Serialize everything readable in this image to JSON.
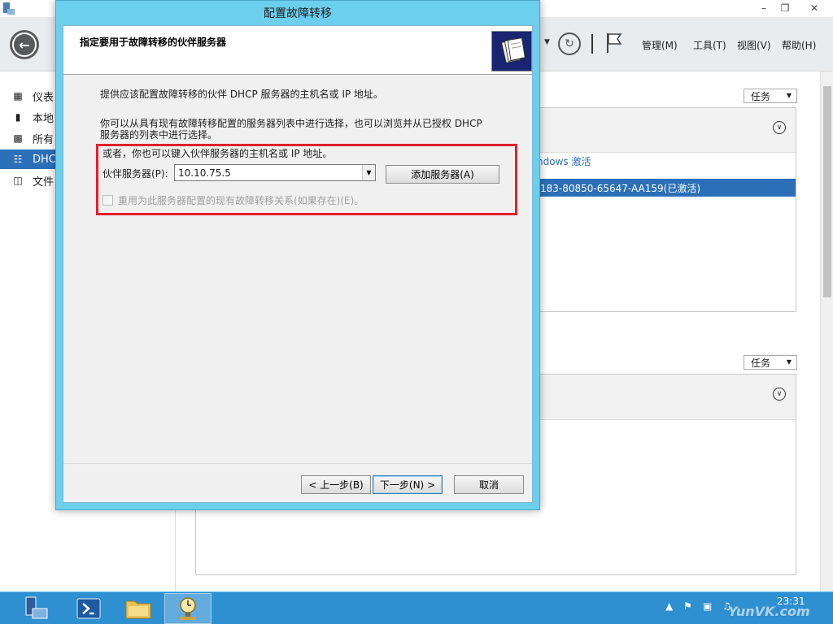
{
  "sm": {
    "toolbar": {
      "menu_manage": "管理(M)",
      "menu_tools": "工具(T)",
      "menu_view": "视图(V)",
      "menu_help": "帮助(H)"
    },
    "sidebar": {
      "items": [
        {
          "label": "仪表"
        },
        {
          "label": "本地"
        },
        {
          "label": "所有"
        },
        {
          "label": "DHC"
        },
        {
          "label": "文件"
        }
      ]
    },
    "tasks_label_1": "任务",
    "tasks_label_2": "任务",
    "column_header": "ndows 激活",
    "selected_row": "183-80850-65647-AA159(已激活)"
  },
  "dialog": {
    "title": "配置故障转移",
    "header_title": "指定要用于故障转移的伙伴服务器",
    "intro_text": "提供应该配置故障转移的伙伴 DHCP 服务器的主机名或 IP 地址。",
    "select_text_line1": "你可以从具有现有故障转移配置的服务器列表中进行选择，也可以浏览并从已授权 DHCP",
    "select_text_line2": "服务器的列表中进行选择。",
    "or_text": "或者，你也可以键入伙伴服务器的主机名或 IP 地址。",
    "partner_label": "伙伴服务器(P):",
    "partner_value": "10.10.75.5",
    "add_server_button": "添加服务器(A)",
    "reuse_checkbox_label": "重用为此服务器配置的现有故障转移关系(如果存在)(E)。",
    "reuse_checked": false,
    "back_button": "< 上一步(B)",
    "next_button": "下一步(N) >",
    "cancel_button": "取消"
  },
  "taskbar": {
    "time": "23:31",
    "watermark": "YunVK.com"
  },
  "colors": {
    "dialog_frame": "#6ccfee",
    "highlight_border": "#e0202a",
    "taskbar": "#2e8fd1",
    "selection": "#2b6fb8"
  }
}
